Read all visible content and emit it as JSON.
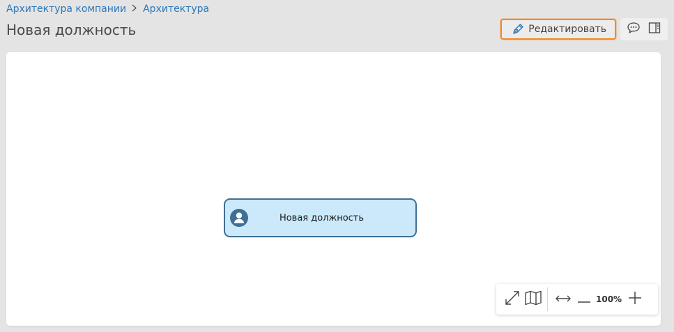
{
  "breadcrumb": {
    "items": [
      "Архитектура компании",
      "Архитектура"
    ]
  },
  "header": {
    "title": "Новая должность",
    "edit_label": "Редактировать"
  },
  "toolbar_icons": [
    "edit-pen-icon",
    "comment-icon",
    "side-panel-icon"
  ],
  "diagram": {
    "node_label": "Новая должность"
  },
  "zoom_controls": {
    "zoom_level": "100%",
    "icons": [
      "fit-screen-icon",
      "map-icon",
      "fit-width-icon",
      "zoom-out-icon",
      "zoom-in-icon"
    ]
  },
  "colors": {
    "accent_link": "#2a77b8",
    "edit_highlight": "#f08a2c",
    "node_fill": "#cbe9fb",
    "node_border": "#3f6f93",
    "background": "#e4e4e4"
  }
}
